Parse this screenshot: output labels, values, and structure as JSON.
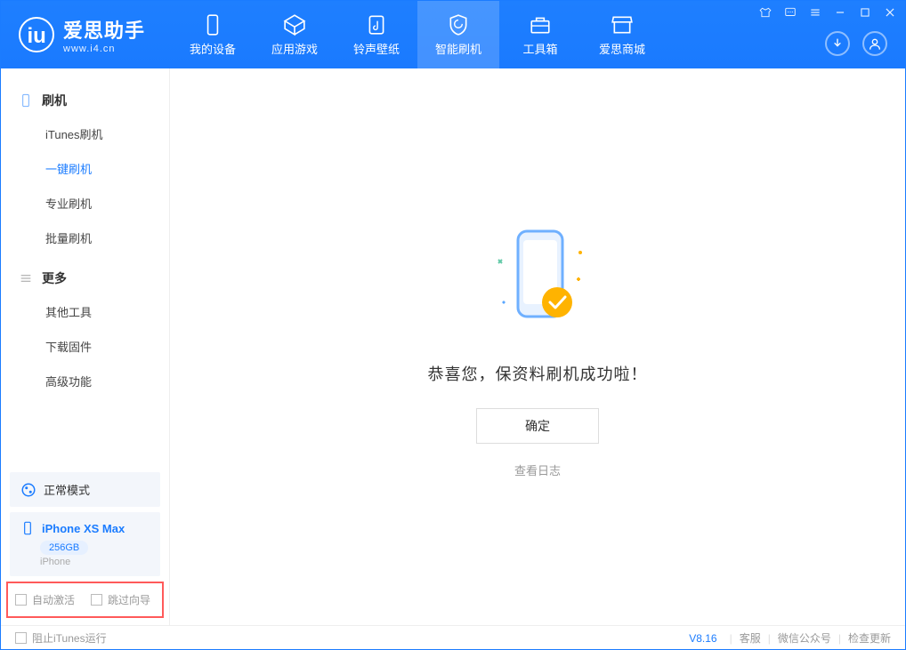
{
  "app": {
    "title": "爱思助手",
    "subtitle": "www.i4.cn"
  },
  "nav": {
    "items": [
      {
        "label": "我的设备"
      },
      {
        "label": "应用游戏"
      },
      {
        "label": "铃声壁纸"
      },
      {
        "label": "智能刷机"
      },
      {
        "label": "工具箱"
      },
      {
        "label": "爱思商城"
      }
    ]
  },
  "sidebar": {
    "group1": {
      "title": "刷机",
      "items": [
        "iTunes刷机",
        "一键刷机",
        "专业刷机",
        "批量刷机"
      ]
    },
    "group2": {
      "title": "更多",
      "items": [
        "其他工具",
        "下载固件",
        "高级功能"
      ]
    },
    "mode": "正常模式",
    "device": {
      "name": "iPhone XS Max",
      "capacity": "256GB",
      "type": "iPhone"
    },
    "checks": {
      "auto_activate": "自动激活",
      "skip_guide": "跳过向导"
    }
  },
  "content": {
    "message": "恭喜您，保资料刷机成功啦！",
    "ok": "确定",
    "log": "查看日志"
  },
  "footer": {
    "block_itunes": "阻止iTunes运行",
    "version": "V8.16",
    "links": [
      "客服",
      "微信公众号",
      "检查更新"
    ]
  }
}
